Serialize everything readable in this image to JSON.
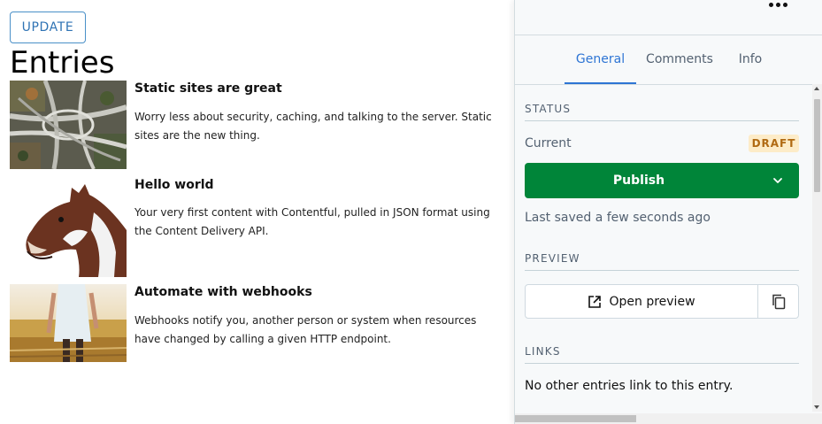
{
  "toolbar": {
    "update_label": "UPDATE"
  },
  "page": {
    "title": "Entries"
  },
  "entries": [
    {
      "title": "Static sites are great",
      "text": "Worry less about security, caching, and talking to the server. Static sites are the new thing.",
      "image": "highway-interchange-aerial"
    },
    {
      "title": "Hello world",
      "text": "Your very first content with Contentful, pulled in JSON format using the Content Delivery API.",
      "image": "horse-head"
    },
    {
      "title": "Automate with webhooks",
      "text": "Webhooks notify you, another person or system when resources have changed by calling a given HTTP endpoint.",
      "image": "woman-in-wheat-field"
    }
  ],
  "sidebar": {
    "more_icon": "more-horizontal-icon",
    "tabs": [
      {
        "label": "General",
        "active": true
      },
      {
        "label": "Comments",
        "active": false
      },
      {
        "label": "Info",
        "active": false
      }
    ],
    "status": {
      "heading": "STATUS",
      "current_label": "Current",
      "badge": "DRAFT",
      "publish_label": "Publish",
      "last_saved": "Last saved a few seconds ago"
    },
    "preview": {
      "heading": "PREVIEW",
      "open_label": "Open preview",
      "open_icon": "external-link-icon",
      "copy_icon": "copy-icon"
    },
    "links": {
      "heading": "LINKS",
      "text": "No other entries link to this entry."
    }
  },
  "colors": {
    "accent": "#2e75d4",
    "publish_green": "#008539",
    "draft_bg": "#fdecc8",
    "draft_text": "#b06a12",
    "update_border": "#4a90c8"
  }
}
